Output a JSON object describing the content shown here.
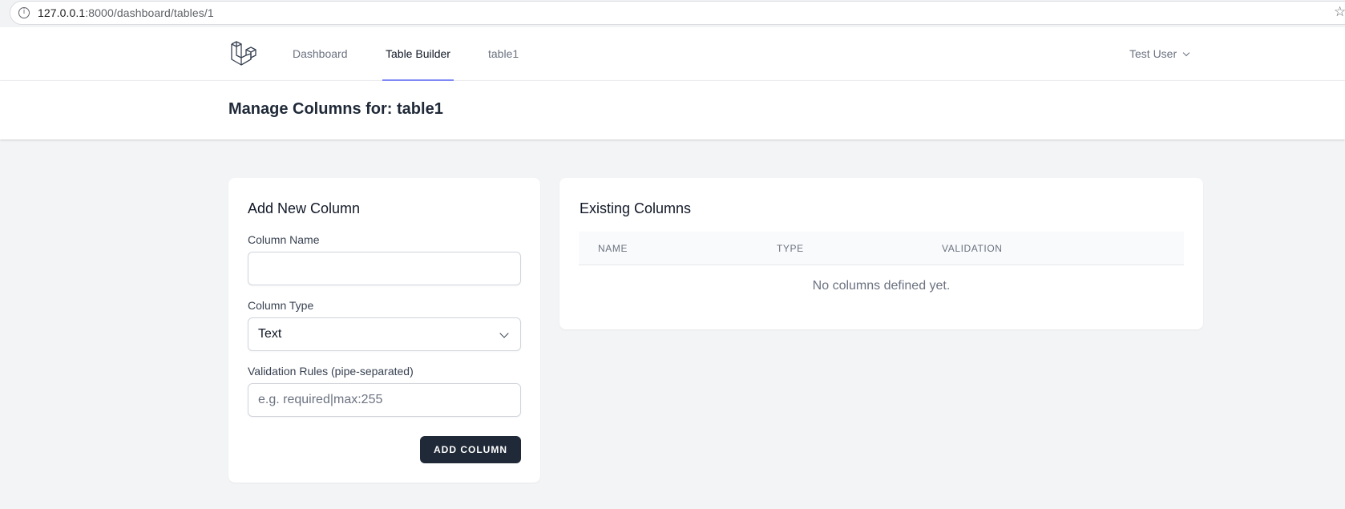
{
  "browser": {
    "url_host": "127.0.0.1",
    "url_path": ":8000/dashboard/tables/1"
  },
  "nav": {
    "links": [
      {
        "label": "Dashboard"
      },
      {
        "label": "Table Builder"
      },
      {
        "label": "table1"
      }
    ],
    "user": "Test User"
  },
  "header": {
    "title": "Manage Columns for: table1"
  },
  "add_form": {
    "title": "Add New Column",
    "name_label": "Column Name",
    "name_value": "",
    "type_label": "Column Type",
    "type_value": "Text",
    "rules_label": "Validation Rules (pipe-separated)",
    "rules_placeholder": "e.g. required|max:255",
    "submit_label": "ADD COLUMN"
  },
  "existing": {
    "title": "Existing Columns",
    "headers": [
      "NAME",
      "TYPE",
      "VALIDATION"
    ],
    "empty_text": "No columns defined yet."
  }
}
